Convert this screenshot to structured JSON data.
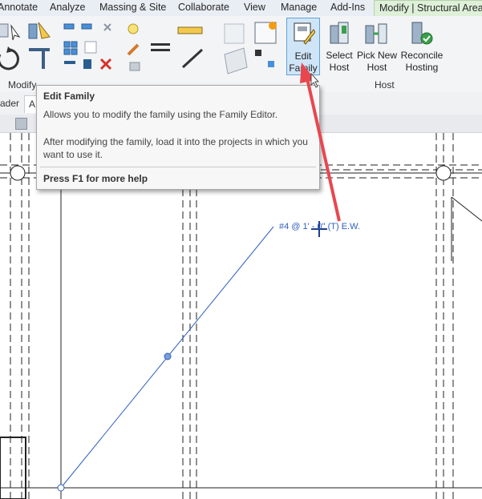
{
  "tabs": [
    "Annotate",
    "Analyze",
    "Massing & Site",
    "Collaborate",
    "View",
    "Manage",
    "Add-Ins",
    "Modify | Structural Area"
  ],
  "ribbon": {
    "groups": {
      "modify": "Modify",
      "host": "Host"
    },
    "buttons": {
      "edit_family": [
        "Edit",
        "Family"
      ],
      "select_host": [
        "Select",
        "Host"
      ],
      "pick_new_host": [
        "Pick New",
        "Host"
      ],
      "reconcile_hosting": [
        "Reconcile",
        "Hosting"
      ]
    }
  },
  "subbar": {
    "left_text": "ader",
    "tab_text": "A"
  },
  "tooltip": {
    "title": "Edit Family",
    "description": "Allows you to modify the family using the Family Editor.",
    "note": "After modifying the family, load it into the projects in which you want to use it.",
    "help": "Press F1 for more help"
  },
  "canvas": {
    "rebar_tag": "#4 @ 1' - 0\" (T) E.W."
  },
  "colors": {
    "accent_tab": "#dff0d9",
    "arrow": "#e8474f",
    "annotation": "#2f5fbf"
  }
}
